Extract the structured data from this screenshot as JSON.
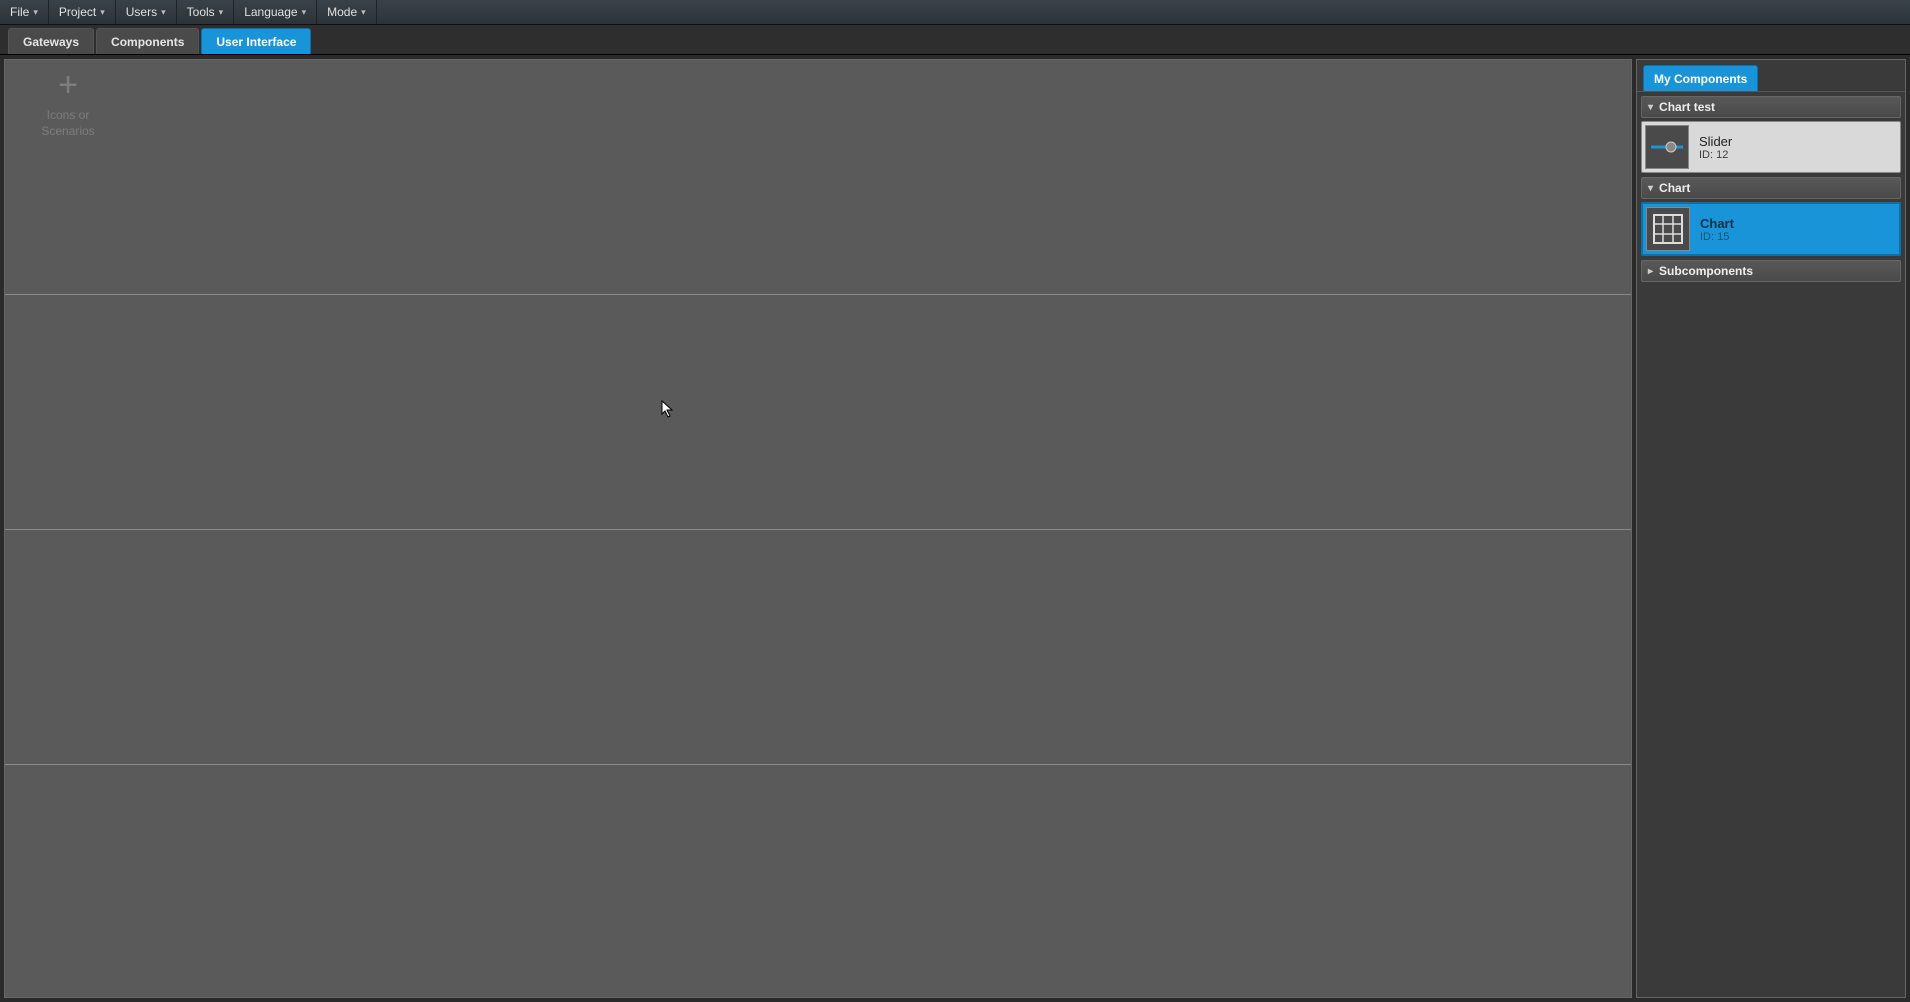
{
  "menu": {
    "items": [
      "File",
      "Project",
      "Users",
      "Tools",
      "Language",
      "Mode"
    ]
  },
  "tabs": {
    "items": [
      {
        "label": "Gateways",
        "active": false
      },
      {
        "label": "Components",
        "active": false
      },
      {
        "label": "User Interface",
        "active": true
      }
    ]
  },
  "canvas": {
    "cell": {
      "line1": "Icons or",
      "line2": "Scenarios",
      "plus": "+"
    }
  },
  "sidebar": {
    "tab_label": "My Components",
    "groups": [
      {
        "label": "Chart test",
        "expanded": true,
        "items": [
          {
            "name": "Slider",
            "id_label": "ID: 12",
            "icon": "slider",
            "selected": false
          }
        ]
      },
      {
        "label": "Chart",
        "expanded": true,
        "items": [
          {
            "name": "Chart",
            "id_label": "ID: 15",
            "icon": "chart",
            "selected": true
          }
        ]
      },
      {
        "label": "Subcomponents",
        "expanded": false,
        "items": []
      }
    ]
  }
}
